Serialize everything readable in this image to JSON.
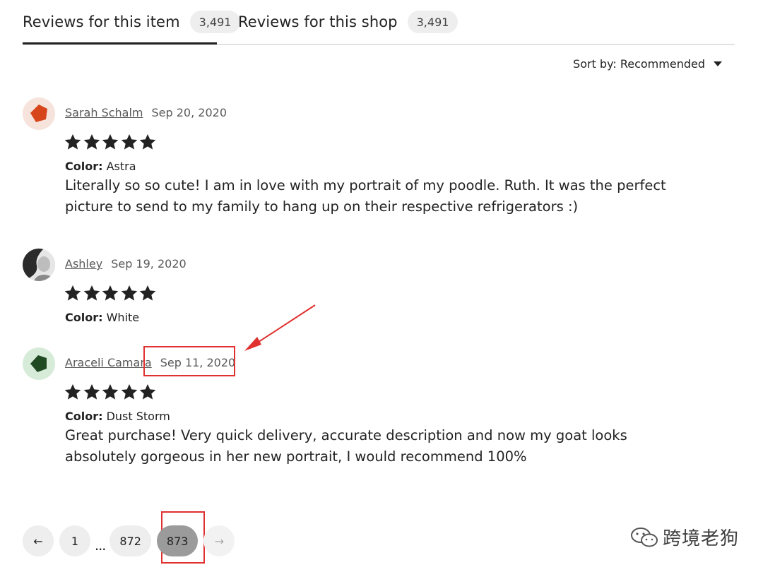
{
  "tabs": [
    {
      "label": "Reviews for this item",
      "count": "3,491",
      "active": true
    },
    {
      "label": "Reviews for this shop",
      "count": "3,491",
      "active": false
    }
  ],
  "sort": {
    "label": "Sort by: Recommended"
  },
  "reviews": [
    {
      "name": "Sarah Schalm",
      "date": "Sep 20, 2020",
      "rating": 5,
      "color_label": "Color:",
      "color_value": "Astra",
      "text": "Literally so so cute! I am in love with my portrait of my poodle. Ruth. It was the perfect picture to send to my family to hang up on their respective refrigerators :)",
      "avatar_color": "#d6461a",
      "avatar_bg": "#f6e3dc"
    },
    {
      "name": "Ashley",
      "date": "Sep 19, 2020",
      "rating": 5,
      "color_label": "Color:",
      "color_value": "White",
      "text": "",
      "avatar_color": "#4a4a4a",
      "avatar_bg": "#d8d8d8"
    },
    {
      "name": "Araceli Camara",
      "date": "Sep 11, 2020",
      "rating": 5,
      "color_label": "Color:",
      "color_value": "Dust Storm",
      "text": "Great purchase! Very quick delivery, accurate description and now my goat looks absolutely gorgeous in her new portrait, I would recommend 100%",
      "avatar_color": "#1f4a22",
      "avatar_bg": "#d7ecd8"
    }
  ],
  "pagination": {
    "prev": "←",
    "first": "1",
    "ellipsis": "...",
    "pages": [
      "872",
      "873"
    ],
    "current": "873",
    "next": "→"
  },
  "watermark": {
    "text": "跨境老狗"
  },
  "colors": {
    "annotation": "#e03030",
    "badge_bg": "#eeeeee",
    "current_page_bg": "#9b9b9b"
  }
}
